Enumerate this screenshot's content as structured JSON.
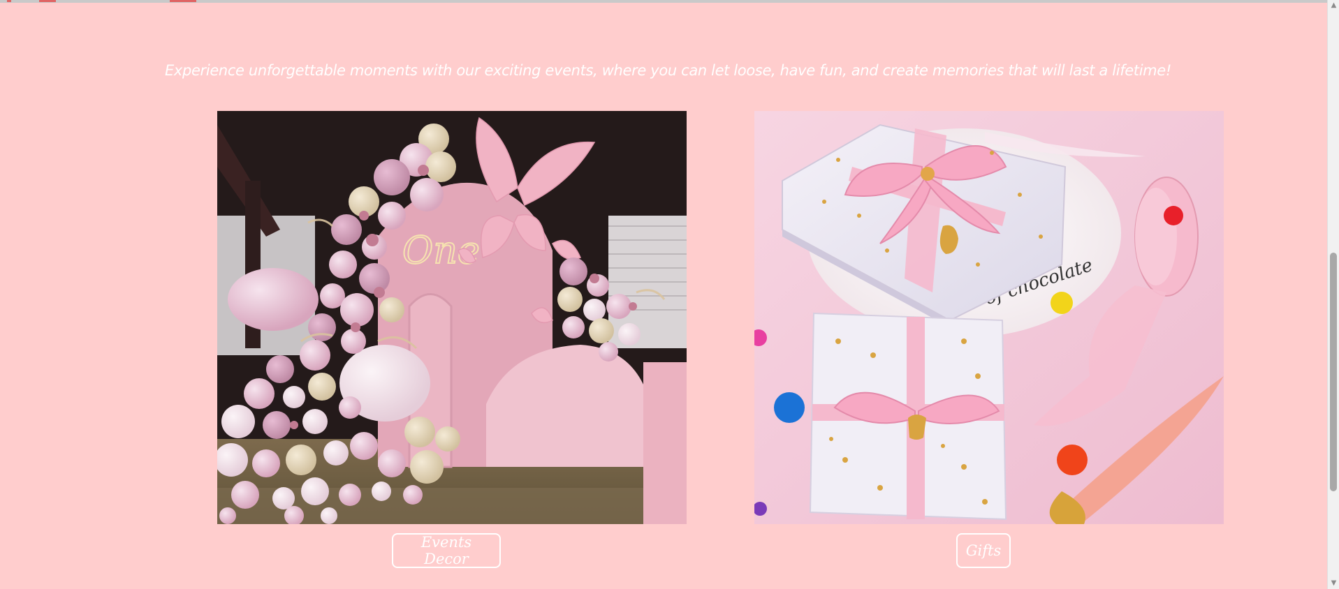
{
  "section": {
    "tagline": "Experience unforgettable moments with our exciting events, where you can let loose, have fun, and create memories that will last a lifetime!"
  },
  "cards": [
    {
      "button_label": "Events Decor",
      "image_description": "Pink balloon arch with butterflies",
      "image_text": "One"
    },
    {
      "button_label": "Gifts",
      "image_description": "Wrapped gift boxes with pink ribbon",
      "image_text": "of chocolate"
    }
  ],
  "colors": {
    "background": "#ffcdcd",
    "text": "#ffffff",
    "scrollbar_thumb": "#a8a8a8"
  },
  "scrollbar": {
    "up_icon": "triangle-up-icon",
    "down_icon": "triangle-down-icon"
  }
}
